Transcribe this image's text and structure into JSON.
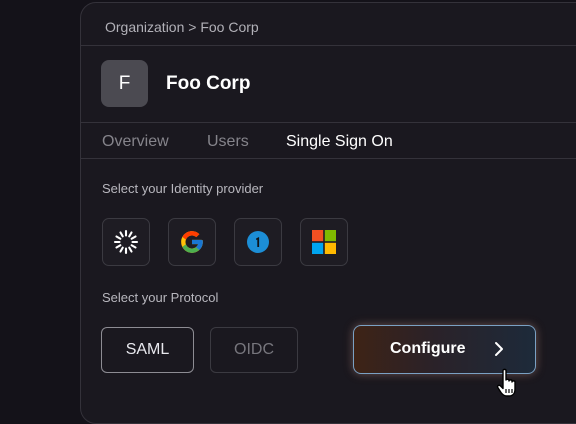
{
  "breadcrumb": "Organization > Foo Corp",
  "organization": {
    "initial": "F",
    "name": "Foo Corp"
  },
  "tabs": [
    {
      "label": "Overview",
      "active": false
    },
    {
      "label": "Users",
      "active": false
    },
    {
      "label": "Single Sign On",
      "active": true
    }
  ],
  "identity_provider": {
    "label": "Select your Identity provider",
    "providers": [
      {
        "icon": "okta-icon"
      },
      {
        "icon": "google-icon"
      },
      {
        "icon": "onelogin-icon"
      },
      {
        "icon": "microsoft-icon"
      }
    ]
  },
  "protocol": {
    "label": "Select your Protocol",
    "options": [
      {
        "label": "SAML",
        "selected": true
      },
      {
        "label": "OIDC",
        "selected": false
      }
    ]
  },
  "configure_button": {
    "label": "Configure"
  },
  "colors": {
    "background": "#141219",
    "panel": "#1a181f",
    "border": "#34323a",
    "active_text": "#ffffff",
    "inactive_text": "#85848b",
    "google_blue": "#4285F4",
    "google_red": "#EA4335",
    "google_yellow": "#FBBC05",
    "google_green": "#34A853",
    "onelogin_blue": "#1c8ed6",
    "ms_red": "#F25022",
    "ms_green": "#7FBA00",
    "ms_blue": "#00A4EF",
    "ms_yellow": "#FFB900"
  }
}
